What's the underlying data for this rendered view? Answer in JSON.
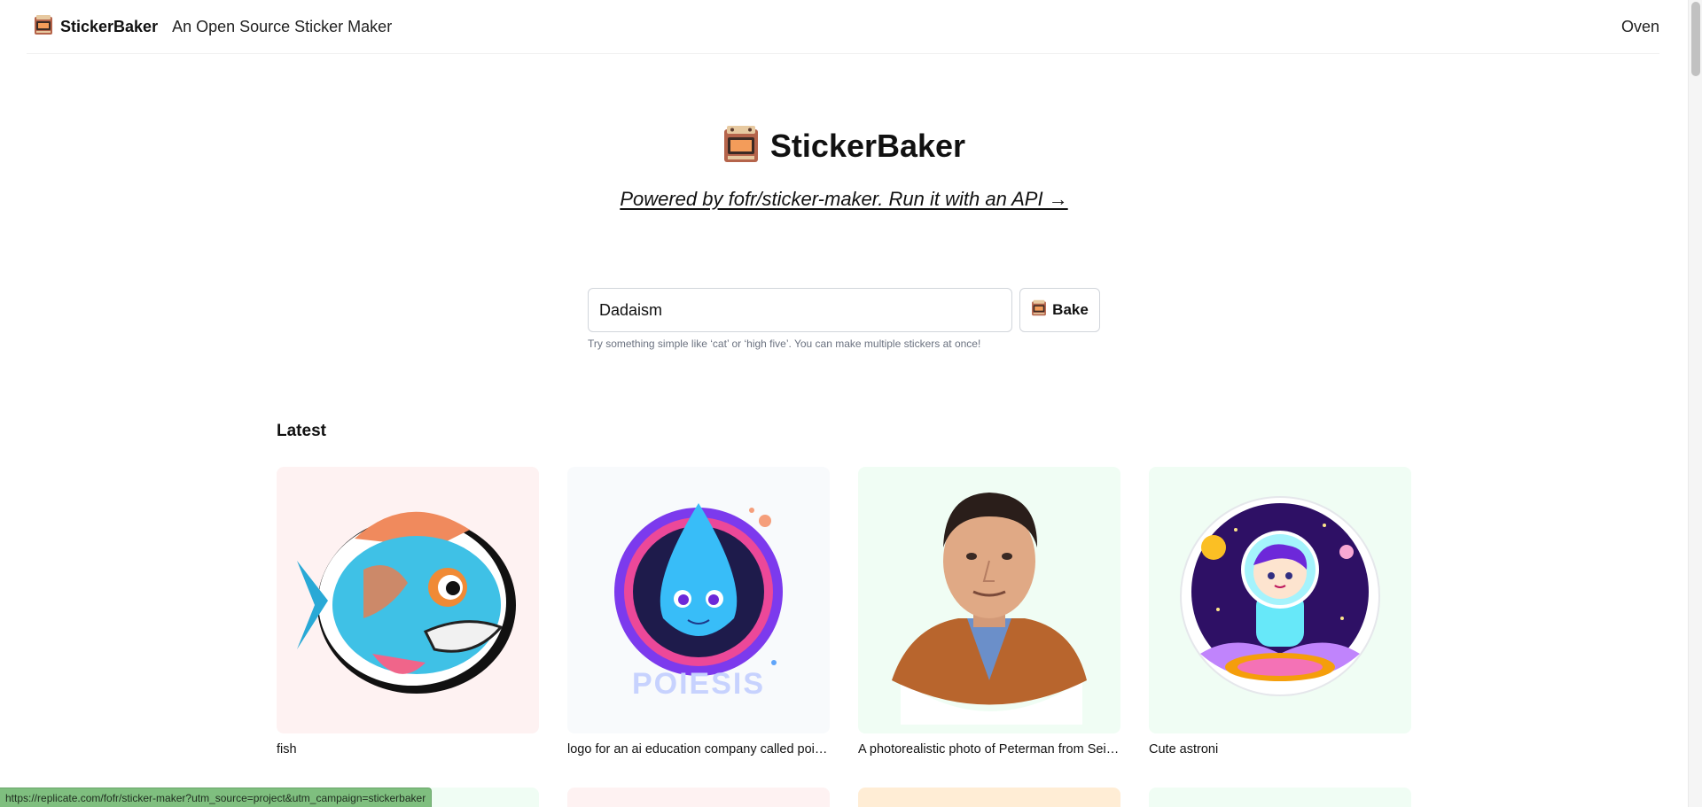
{
  "nav": {
    "brand": "StickerBaker",
    "tagline": "An Open Source Sticker Maker",
    "oven_link": "Oven"
  },
  "hero": {
    "title": "StickerBaker",
    "link_text": "Powered by fofr/sticker-maker. Run it with an API →"
  },
  "search": {
    "value": "Dadaism",
    "bake_label": "Bake",
    "hint": "Try something simple like ‘cat’ or ‘high five’. You can make multiple stickers at once!"
  },
  "latest": {
    "heading": "Latest",
    "items": [
      {
        "caption": "fish",
        "bg": "#fef2f2"
      },
      {
        "caption": "logo for an ai education company called poiesis",
        "bg": "#f8fafc"
      },
      {
        "caption": "A photorealistic photo of Peterman from Seinfeld",
        "bg": "#f0fdf4"
      },
      {
        "caption": "Cute astroni",
        "bg": "#f0fdf4"
      }
    ],
    "row2_bgs": [
      "#f0fdf4",
      "#fef2f2",
      "#ffedd5",
      "#f0fdf4"
    ]
  },
  "status_url": "https://replicate.com/fofr/sticker-maker?utm_source=project&utm_campaign=stickerbaker",
  "colors": {
    "text": "#111827",
    "hint": "#6b7280",
    "border": "#d1d5db",
    "status_bg": "#7fbf7f"
  }
}
